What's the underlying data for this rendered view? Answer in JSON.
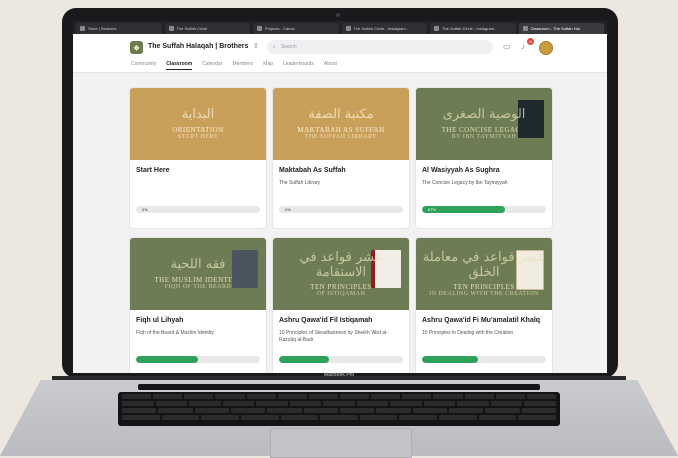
{
  "device": {
    "brand_label": "MacBook Pro"
  },
  "browser": {
    "tabs": [
      {
        "label": "Store | Seasons",
        "active": false
      },
      {
        "label": "The Suffah Circle",
        "active": false
      },
      {
        "label": "Projects - Canva",
        "active": false
      },
      {
        "label": "The Suffah Circle - Instagram...",
        "active": false
      },
      {
        "label": "The Suffah Circle - Instagram...",
        "active": false
      },
      {
        "label": "Classroom - The Suffah Hal",
        "active": true
      }
    ]
  },
  "header": {
    "group_name": "The Suffah Halaqah | Brothers",
    "search_placeholder": "Search",
    "notification_count": "6",
    "nav": [
      {
        "label": "Community",
        "active": false
      },
      {
        "label": "Classroom",
        "active": true
      },
      {
        "label": "Calendar",
        "active": false
      },
      {
        "label": "Members",
        "active": false
      },
      {
        "label": "Map",
        "active": false
      },
      {
        "label": "Leaderboards",
        "active": false
      },
      {
        "label": "About",
        "active": false
      }
    ]
  },
  "courses": [
    {
      "title": "Start Here",
      "subtitle": "",
      "thumb_arabic": "البداية",
      "thumb_line1": "ORIENTATION",
      "thumb_line2": "START HERE",
      "theme": "gold",
      "progress_label": "0%",
      "progress": 0
    },
    {
      "title": "Maktabah As Suffah",
      "subtitle": "The Suffah Library",
      "thumb_arabic": "مكتبة الصفة",
      "thumb_line1": "MAKTABAH AS SUFFAH",
      "thumb_line2": "THE SUFFAH LIBRARY",
      "theme": "gold",
      "progress_label": "0%",
      "progress": 0
    },
    {
      "title": "Al Wasiyyah As Sughra",
      "subtitle": "The Concise Legacy by Ibn Taymiyyah",
      "thumb_arabic": "الوصية الصغرى",
      "thumb_line1": "THE CONCISE LEGACY",
      "thumb_line2": "BY IBN TAYMIYYAH",
      "theme": "green",
      "progress_label": "67%",
      "progress": 67
    },
    {
      "title": "Fiqh ul Lihyah",
      "subtitle": "Fiqh of the Beard & Muslim Identity",
      "thumb_arabic": "فقه اللحية",
      "thumb_line1": "THE MUSLIM IDENTITY",
      "thumb_line2": "FIQH OF THE BEARD",
      "theme": "green",
      "progress_label": "",
      "progress": 50
    },
    {
      "title": "Ashru Qawa'id Fil Istiqamah",
      "subtitle": "10 Principles of Steadfastness by Sheikh 'Abd al-Razzāq al-Badr",
      "thumb_arabic": "عشر قواعد في الاستقامة",
      "thumb_line1": "TEN PRINCIPLES",
      "thumb_line2": "OF ISTIQAMAH",
      "theme": "green",
      "progress_label": "",
      "progress": 40
    },
    {
      "title": "Ashru Qawa'id Fi Mu'amalatil Khalq",
      "subtitle": "10 Principles in Dealing with the Creation",
      "thumb_arabic": "عشر قواعد في معاملة الخلق",
      "thumb_line1": "TEN PRINCIPLES",
      "thumb_line2": "IN DEALING WITH THE CREATION",
      "theme": "green",
      "progress_label": "",
      "progress": 45
    }
  ]
}
